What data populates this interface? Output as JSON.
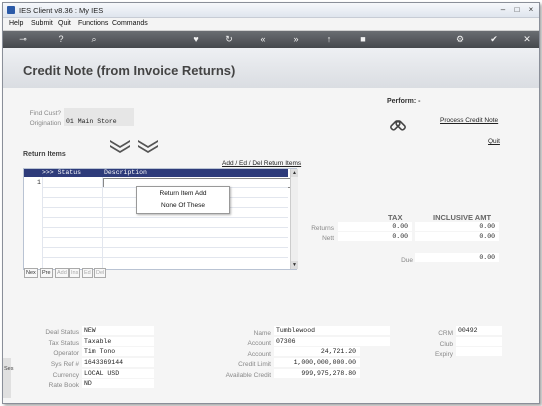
{
  "window": {
    "title": "IES Client v8.36 : My IES",
    "controls": [
      "–",
      "□",
      "×"
    ]
  },
  "menu": [
    "Help",
    "Submit",
    "Quit",
    "Functions",
    "Commands"
  ],
  "toolbar": {
    "icons": [
      "key-icon",
      "help-icon",
      "search-icon",
      "favorite-icon",
      "refresh-icon",
      "back-icon",
      "forward-icon",
      "up-icon",
      "stop-icon",
      "settings-icon",
      "check-icon",
      "close-icon"
    ],
    "glyphs": [
      "⊸",
      "?",
      "⌕",
      "♥",
      "↻",
      "«",
      "»",
      "↑",
      "■",
      "⚙",
      "✔",
      "✕"
    ]
  },
  "page": {
    "title": "Credit Note (from Invoice Returns)"
  },
  "find_cust": {
    "label": "Find Cust?",
    "value": ""
  },
  "origination": {
    "label": "Origination",
    "value": "01 Main Store"
  },
  "perform": {
    "label": "Perform: -",
    "process": "Process Credit Note",
    "quit": "Quit"
  },
  "return_items": {
    "label": "Return Items",
    "links": "Add / Ed / Del Return Items",
    "columns": [
      ">>> Status",
      "Description"
    ],
    "row1": "1",
    "nav": [
      "Nex",
      "Pre",
      "Add",
      "Ins",
      "Ed",
      "Del"
    ]
  },
  "popup": {
    "items": [
      "Return Item Add",
      "None Of These"
    ]
  },
  "totals": {
    "tax_header": "TAX",
    "incl_header": "INCLUSIVE AMT",
    "returns_label": "Returns",
    "returns_tax": "0.00",
    "returns_incl": "0.00",
    "nett_label": "Nett",
    "nett_tax": "0.00",
    "nett_incl": "0.00",
    "due_label": "Due",
    "due_value": "0.00"
  },
  "deal": {
    "status_label": "Deal Status",
    "status": "NEW",
    "tax_label": "Tax Status",
    "tax": "Taxable",
    "operator_label": "Operator",
    "operator": "Tim Tono",
    "sys_label": "Sys Ref #",
    "sys": "1643369144",
    "currency_label": "Currency",
    "currency": "LOCAL USD",
    "rate_label": "Rate Book",
    "rate": "ND"
  },
  "account": {
    "name_label": "Name",
    "name": "Tumblewood",
    "acct_label": "Account",
    "acct": "07306",
    "bal_label": "Account",
    "bal": "24,721.20",
    "limit_label": "Credit Limit",
    "limit": "1,000,000,000.00",
    "avail_label": "Available Credit",
    "avail": "999,975,278.80"
  },
  "crm": {
    "crm_label": "CRM",
    "crm": "00492",
    "club_label": "Club",
    "club": "",
    "expiry_label": "Expiry",
    "expiry": ""
  },
  "side": {
    "label": "Ses"
  }
}
